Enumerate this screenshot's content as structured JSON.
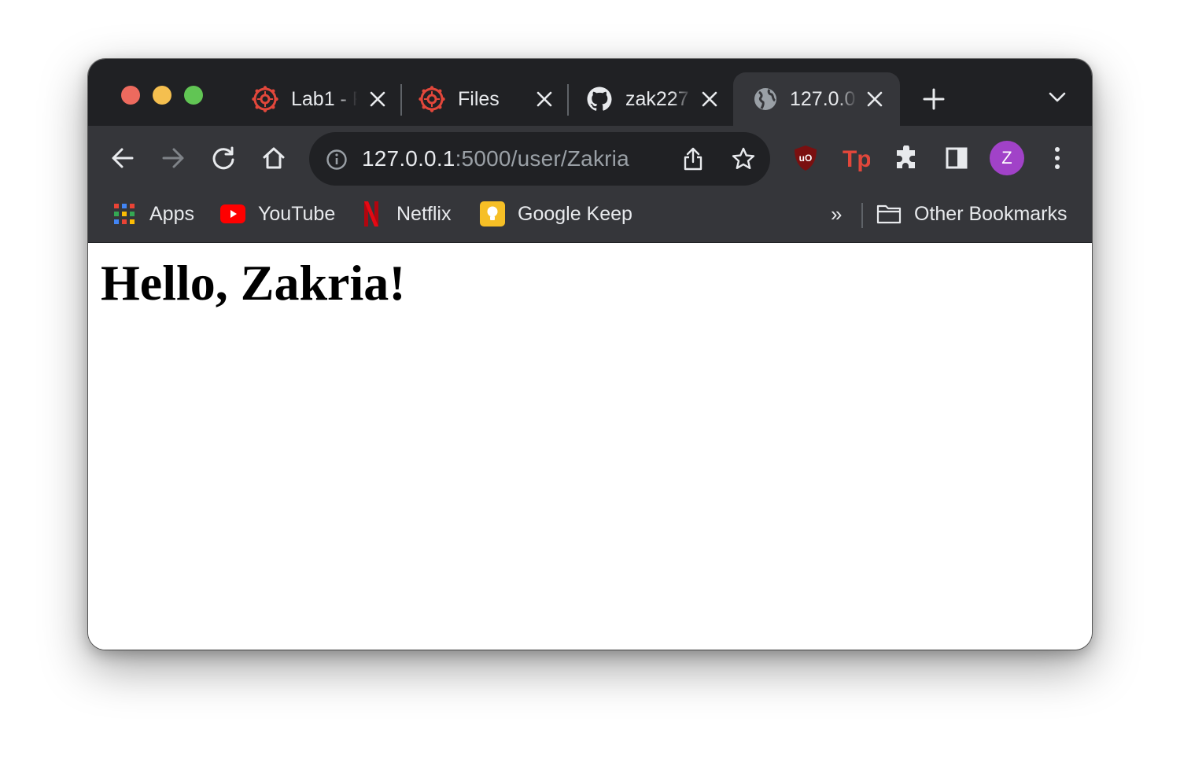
{
  "tabs": [
    {
      "title": "Lab1 - F",
      "icon": "canvas-icon",
      "active": false
    },
    {
      "title": "Files",
      "icon": "canvas-icon",
      "active": false
    },
    {
      "title": "zak227",
      "icon": "github-icon",
      "active": false
    },
    {
      "title": "127.0.0",
      "icon": "globe-icon",
      "active": true
    }
  ],
  "omnibox": {
    "host": "127.0.0.1",
    "path": ":5000/user/Zakria"
  },
  "profile": {
    "initial": "Z",
    "color": "#a142c8"
  },
  "bookmarks": {
    "items": [
      {
        "label": "Apps",
        "icon": "apps-grid-icon"
      },
      {
        "label": "YouTube",
        "icon": "youtube-icon"
      },
      {
        "label": "Netflix",
        "icon": "netflix-icon"
      },
      {
        "label": "Google Keep",
        "icon": "google-keep-icon"
      }
    ],
    "overflow": "»",
    "other": "Other Bookmarks"
  },
  "page": {
    "heading": "Hello, Zakria!"
  },
  "colors": {
    "tabstrip": "#202124",
    "toolbar": "#35363a",
    "omnibox": "#202124",
    "text": "#e8eaed"
  }
}
